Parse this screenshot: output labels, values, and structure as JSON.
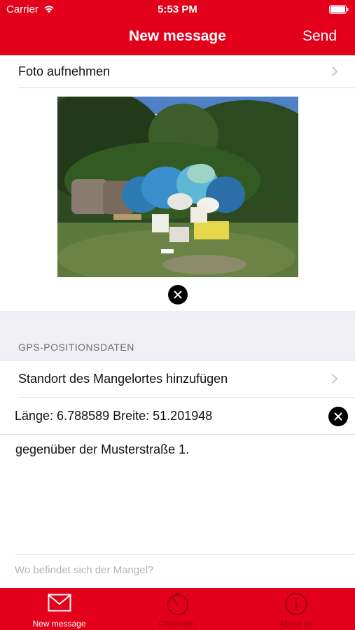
{
  "status_bar": {
    "carrier": "Carrier",
    "time": "5:53 PM"
  },
  "nav": {
    "title": "New message",
    "send_label": "Send"
  },
  "photo_row": {
    "label": "Foto aufnehmen"
  },
  "gps_section": {
    "header": "GPS-POSITIONSDATEN",
    "add_location_label": "Standort des Mangelortes hinzufügen",
    "coordinates": "Länge: 6.788589 Breite: 51.201948"
  },
  "description": {
    "text": "gegenüber der Musterstraße 1.",
    "placeholder": "Wo befindet sich der Mangel?"
  },
  "tabbar": {
    "tabs": [
      {
        "label": "New message",
        "icon": "envelope-icon",
        "active": true
      },
      {
        "label": "Checklists",
        "icon": "timer-icon",
        "active": false
      },
      {
        "label": "About us",
        "icon": "info-icon",
        "active": false
      }
    ]
  },
  "colors": {
    "brand": "#e3001b",
    "section_bg": "#efeff4"
  }
}
